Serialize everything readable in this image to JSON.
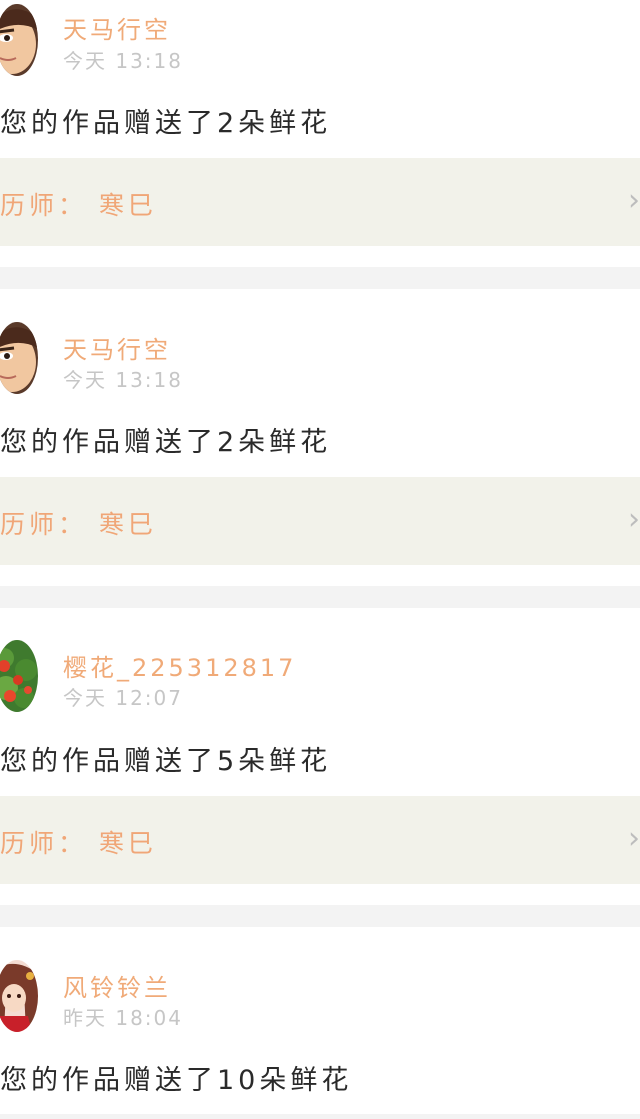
{
  "notifications": [
    {
      "username": "天马行空",
      "time": "今天 13:18",
      "message": "您的作品赠送了2朵鲜花",
      "work_label": "历师： 寒巳",
      "avatar_icon": "cartoon-man-avatar"
    },
    {
      "username": "天马行空",
      "time": "今天 13:18",
      "message": "您的作品赠送了2朵鲜花",
      "work_label": "历师： 寒巳",
      "avatar_icon": "cartoon-man-avatar"
    },
    {
      "username": "樱花_225312817",
      "time": "今天 12:07",
      "message": "您的作品赠送了5朵鲜花",
      "work_label": "历师： 寒巳",
      "avatar_icon": "tomato-plant-avatar"
    },
    {
      "username": "风铃铃兰",
      "time": "昨天 18:04",
      "message": "您的作品赠送了10朵鲜花",
      "avatar_icon": "anime-girl-avatar"
    }
  ],
  "colors": {
    "username": "#f0aa78",
    "work_label": "#f0a677",
    "work_row_bg": "#f2f2ea",
    "time": "#c6c6c6",
    "message": "#2a2a2a"
  },
  "icons": {
    "chevron": "chevron-right-icon"
  }
}
